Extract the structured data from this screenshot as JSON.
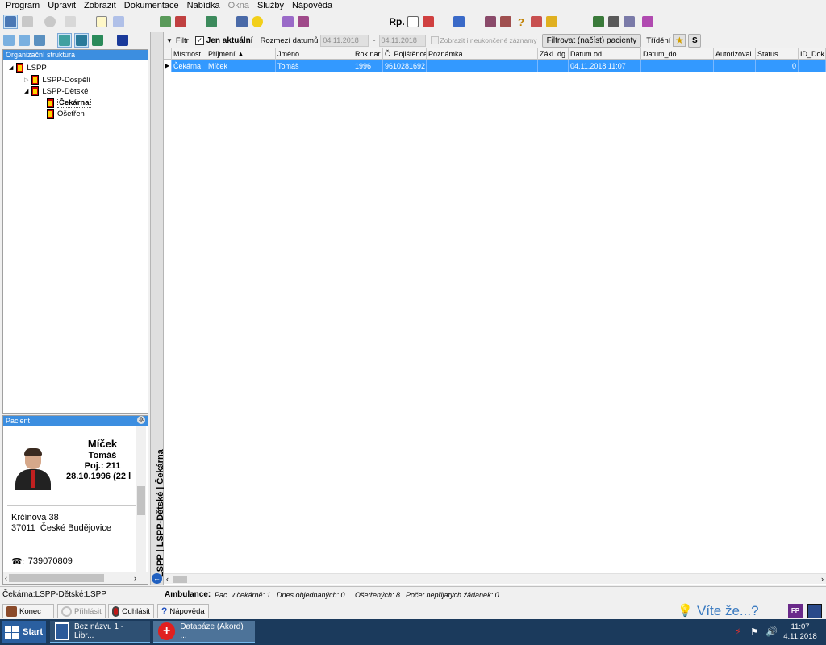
{
  "menu": [
    "Program",
    "Upravit",
    "Zobrazit",
    "Dokumentace",
    "Nabídka",
    "Okna",
    "Služby",
    "Nápověda"
  ],
  "menu_disabled": [
    "Okna"
  ],
  "toolbar": {
    "rp_label": "Rp."
  },
  "org": {
    "header": "Organizační struktura",
    "tree": [
      {
        "label": "LSPP",
        "level": 0,
        "expanded": true,
        "bold": false
      },
      {
        "label": "LSPP-Dospělí",
        "level": 1,
        "expanded": false,
        "bold": false
      },
      {
        "label": "LSPP-Dětské",
        "level": 1,
        "expanded": true,
        "bold": false
      },
      {
        "label": "Čekárna",
        "level": 2,
        "expanded": false,
        "bold": true
      },
      {
        "label": "Ošetřen",
        "level": 2,
        "expanded": false,
        "bold": false
      }
    ]
  },
  "patient": {
    "header": "Pacient",
    "surname": "Míček",
    "firstname": "Tomáš",
    "insurance": "Poj.: 211",
    "birth": "28.10.1996 (22 l",
    "street": "Krčínova 38",
    "city": "37011  České Budějovice",
    "phone": "739070809"
  },
  "vertical_tab": "LSPP | LSPP-Dětské | Čekárna",
  "filter": {
    "filter_label": "Filtr",
    "only_current_label": "Jen aktuální",
    "only_current_checked": true,
    "date_range_label": "Rozmezí datumů",
    "date_from": "04.11.2018",
    "date_to": "04.11.2018",
    "show_unfinished_label": "Zobrazit i neukončené záznamy",
    "show_unfinished_checked": false,
    "apply_button": "Filtrovat (načíst) pacienty",
    "sort_label": "Třídění",
    "s_button": "S"
  },
  "table": {
    "columns": [
      "Místnost",
      "Příjmení ▲",
      "Jméno",
      "Rok.nar.",
      "Č. Pojištěnce",
      "Poznámka",
      "Zákl. dg.",
      "Datum od",
      "Datum_do",
      "Autorizoval",
      "Status",
      "ID_Dok"
    ],
    "rows": [
      [
        "Čekárna",
        "Míček",
        "Tomáš",
        "1996",
        "9610281692",
        "",
        "",
        "04.11.2018 11:07",
        "",
        "",
        "0",
        ""
      ]
    ]
  },
  "status": {
    "location": "Čekárna:LSPP-Dětské:LSPP",
    "ambulance_label": "Ambulance:",
    "waiting": "Pac. v čekárně: 1",
    "ordered": "Dnes objednaných: 0",
    "treated": "Ošetřených: 8",
    "unaccepted": "Počet nepřijatých žádanek: 0"
  },
  "buttons": {
    "end": "Konec",
    "login": "Přihlásit",
    "logout": "Odhlásit",
    "help": "Nápověda",
    "tip": "Víte že...?",
    "fp": "FP"
  },
  "taskbar": {
    "start": "Start",
    "tasks": [
      "Bez názvu 1 - Libr...",
      "Databáze (Akord) ..."
    ],
    "time": "11:07",
    "date": "4.11.2018"
  }
}
